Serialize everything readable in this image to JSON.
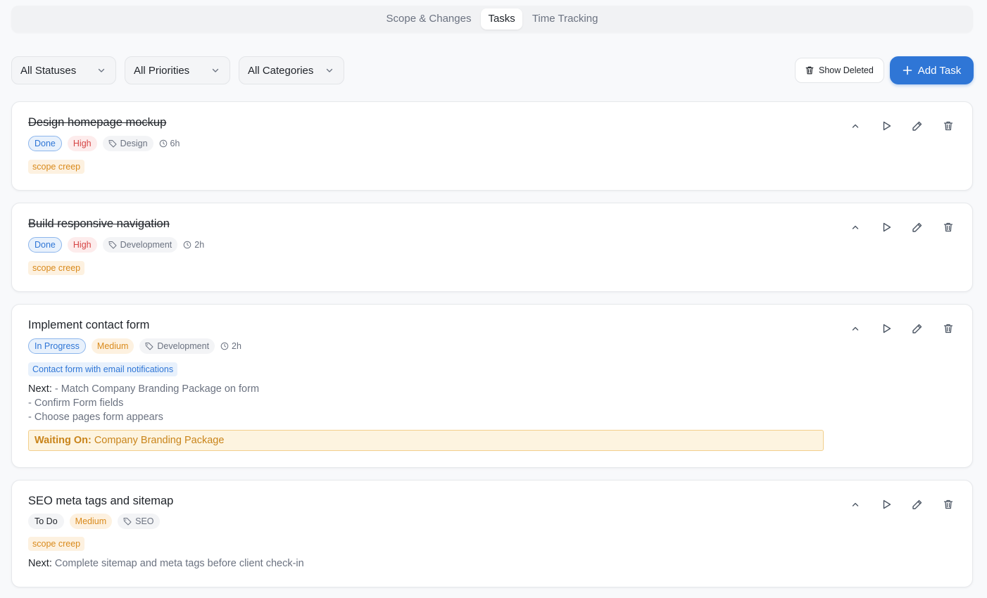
{
  "tabs": [
    {
      "label": "Scope & Changes",
      "active": false
    },
    {
      "label": "Tasks",
      "active": true
    },
    {
      "label": "Time Tracking",
      "active": false
    }
  ],
  "filters": {
    "status": "All Statuses",
    "priority": "All Priorities",
    "category": "All Categories"
  },
  "toolbar": {
    "show_deleted_label": "Show Deleted",
    "add_task_label": "Add Task"
  },
  "tasks": [
    {
      "title": "Design homepage mockup",
      "completed": true,
      "status": "Done",
      "priority": "High",
      "category": "Design",
      "estimate": "6h",
      "tag": "scope creep"
    },
    {
      "title": "Build responsive navigation",
      "completed": true,
      "status": "Done",
      "priority": "High",
      "category": "Development",
      "estimate": "2h",
      "tag": "scope creep"
    },
    {
      "title": "Implement contact form",
      "completed": false,
      "status": "In Progress",
      "priority": "Medium",
      "category": "Development",
      "estimate": "2h",
      "tag": "Contact form with email notifications",
      "next_label": "Next:",
      "next_lines": [
        "- Match Company Branding Package on form",
        "- Confirm Form fields",
        "- Choose pages form appears"
      ],
      "waiting_label": "Waiting On:",
      "waiting_value": "Company Branding Package"
    },
    {
      "title": "SEO meta tags and sitemap",
      "completed": false,
      "status": "To Do",
      "priority": "Medium",
      "category": "SEO",
      "tag": "scope creep",
      "next_label": "Next:",
      "next_text": "Complete sitemap and meta tags before client check-in"
    }
  ],
  "colors": {
    "accent": "#2f76d6",
    "high": "#d64545",
    "medium": "#d98a1c"
  }
}
